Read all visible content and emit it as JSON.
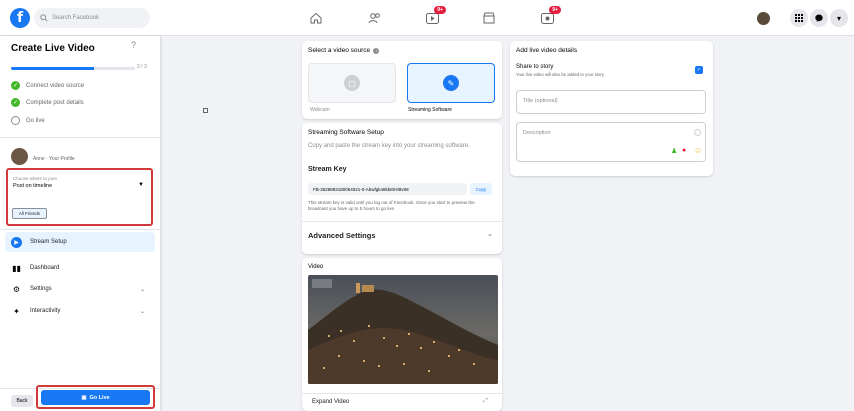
{
  "topbar": {
    "search_placeholder": "Search Facebook",
    "notification_badge_1": "9+",
    "notification_badge_2": "9+"
  },
  "left": {
    "title": "Create Live Video",
    "help_icon": "?",
    "progress_fraction": 0.67,
    "step_count": "2 / 3",
    "steps": [
      {
        "label": "Connect video source",
        "done": true
      },
      {
        "label": "Complete post details",
        "done": true
      },
      {
        "label": "Go live",
        "done": false
      }
    ],
    "profile_name": "Anne · Your Profile",
    "dropdown_label": "Choose where to post",
    "dropdown_value": "Post on timeline",
    "audience_button": "All Friends",
    "menu": [
      {
        "label": "Stream Setup",
        "icon": "video-camera-icon",
        "active": true
      },
      {
        "label": "Dashboard",
        "icon": "dashboard-icon",
        "active": false
      },
      {
        "label": "Settings",
        "icon": "gear-icon",
        "active": false
      },
      {
        "label": "Interactivity",
        "icon": "interactivity-icon",
        "active": false
      }
    ],
    "back_label": "Back",
    "golive_label": "Go Live"
  },
  "middle": {
    "source_title": "Select a video source",
    "sources": [
      {
        "label": "Webcam",
        "selected": false
      },
      {
        "label": "Streaming Software",
        "selected": true
      }
    ],
    "setup_title": "Streaming Software Setup",
    "setup_desc": "Copy and paste the stream key into your streaming software.",
    "stream_key_label": "Stream Key",
    "stream_key_value": "FB-3528892180054021-0-Abwfgk48kb8rHt8v88",
    "copy_label": "Copy",
    "key_note": "This stream key is valid until you log out of Facebook. Once you start to preview the broadcast you have up to 5 hours to go live.",
    "advanced_label": "Advanced Settings",
    "video_title": "Video",
    "expand_label": "Expand Video"
  },
  "right": {
    "title": "Add live video details",
    "share_label": "Share to story",
    "share_desc": "Your live video will also be added to your story",
    "share_checked": true,
    "title_placeholder": "Title (optional)",
    "description_placeholder": "Description"
  },
  "colors": {
    "accent": "#1877f2",
    "highlight": "#d03a3a",
    "check": "#42b72a"
  }
}
